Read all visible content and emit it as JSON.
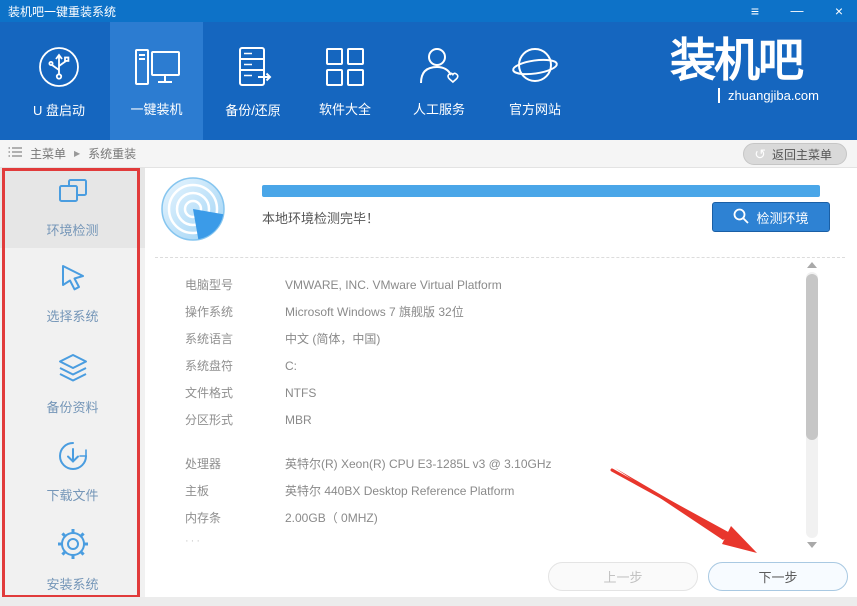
{
  "titlebar": {
    "title": "装机吧一键重装系统",
    "menu_icon": "≡",
    "minimize_icon": "—",
    "close_icon": "×"
  },
  "nav": {
    "items": [
      {
        "label": "U 盘启动",
        "icon": "usb-icon",
        "active": false
      },
      {
        "label": "一键装机",
        "icon": "computer-icon",
        "active": true
      },
      {
        "label": "备份/还原",
        "icon": "server-icon",
        "active": false
      },
      {
        "label": "软件大全",
        "icon": "grid-icon",
        "active": false
      },
      {
        "label": "人工服务",
        "icon": "person-icon",
        "active": false
      },
      {
        "label": "官方网站",
        "icon": "globe-icon",
        "active": false
      }
    ],
    "logo": {
      "text": "装机吧",
      "subtext": "zhuangjiba.com"
    }
  },
  "breadcrumb": {
    "root": "主菜单",
    "separator": "▶",
    "current": "系统重装",
    "back_button_label": "返回主菜单",
    "back_icon": "↺"
  },
  "sidebar": {
    "items": [
      {
        "label": "环境检测",
        "icon": "windows-overlap-icon",
        "active": true
      },
      {
        "label": "选择系统",
        "icon": "cursor-icon",
        "active": false
      },
      {
        "label": "备份资料",
        "icon": "layers-icon",
        "active": false
      },
      {
        "label": "下载文件",
        "icon": "download-icon",
        "active": false
      },
      {
        "label": "安装系统",
        "icon": "gear-icon",
        "active": false
      }
    ],
    "annotation": "red-rectangle-highlight"
  },
  "detection": {
    "status_text": "本地环境检测完毕！",
    "progress_percent": 100,
    "detect_button_label": "检测环境"
  },
  "system_info": {
    "rows": [
      {
        "label": "电脑型号",
        "value": "VMWARE, INC. VMware Virtual Platform"
      },
      {
        "label": "操作系统",
        "value": "Microsoft Windows 7 旗舰版  32位"
      },
      {
        "label": "系统语言",
        "value": "中文 (简体，中国)"
      },
      {
        "label": "系统盘符",
        "value": "C:"
      },
      {
        "label": "文件格式",
        "value": "NTFS"
      },
      {
        "label": "分区形式",
        "value": "MBR"
      },
      {
        "label": "处理器",
        "value": "英特尔(R) Xeon(R) CPU E3-1285L v3 @ 3.10GHz"
      },
      {
        "label": "主板",
        "value": "英特尔 440BX Desktop Reference Platform"
      },
      {
        "label": "内存条",
        "value": "2.00GB（ 0MHZ)"
      }
    ],
    "truncated_hint": "···"
  },
  "footer": {
    "prev_button_label": "上一步",
    "next_button_label": "下一步"
  },
  "annotations": {
    "arrow_color": "#e8362c",
    "box_color": "#e13b3b"
  },
  "colors": {
    "titlebar_blue": "#0d72c8",
    "header_blue": "#1566bf",
    "active_nav_blue": "#2c7cd1",
    "accent_blue": "#2e82d3",
    "progress_blue": "#4aa6e8"
  }
}
